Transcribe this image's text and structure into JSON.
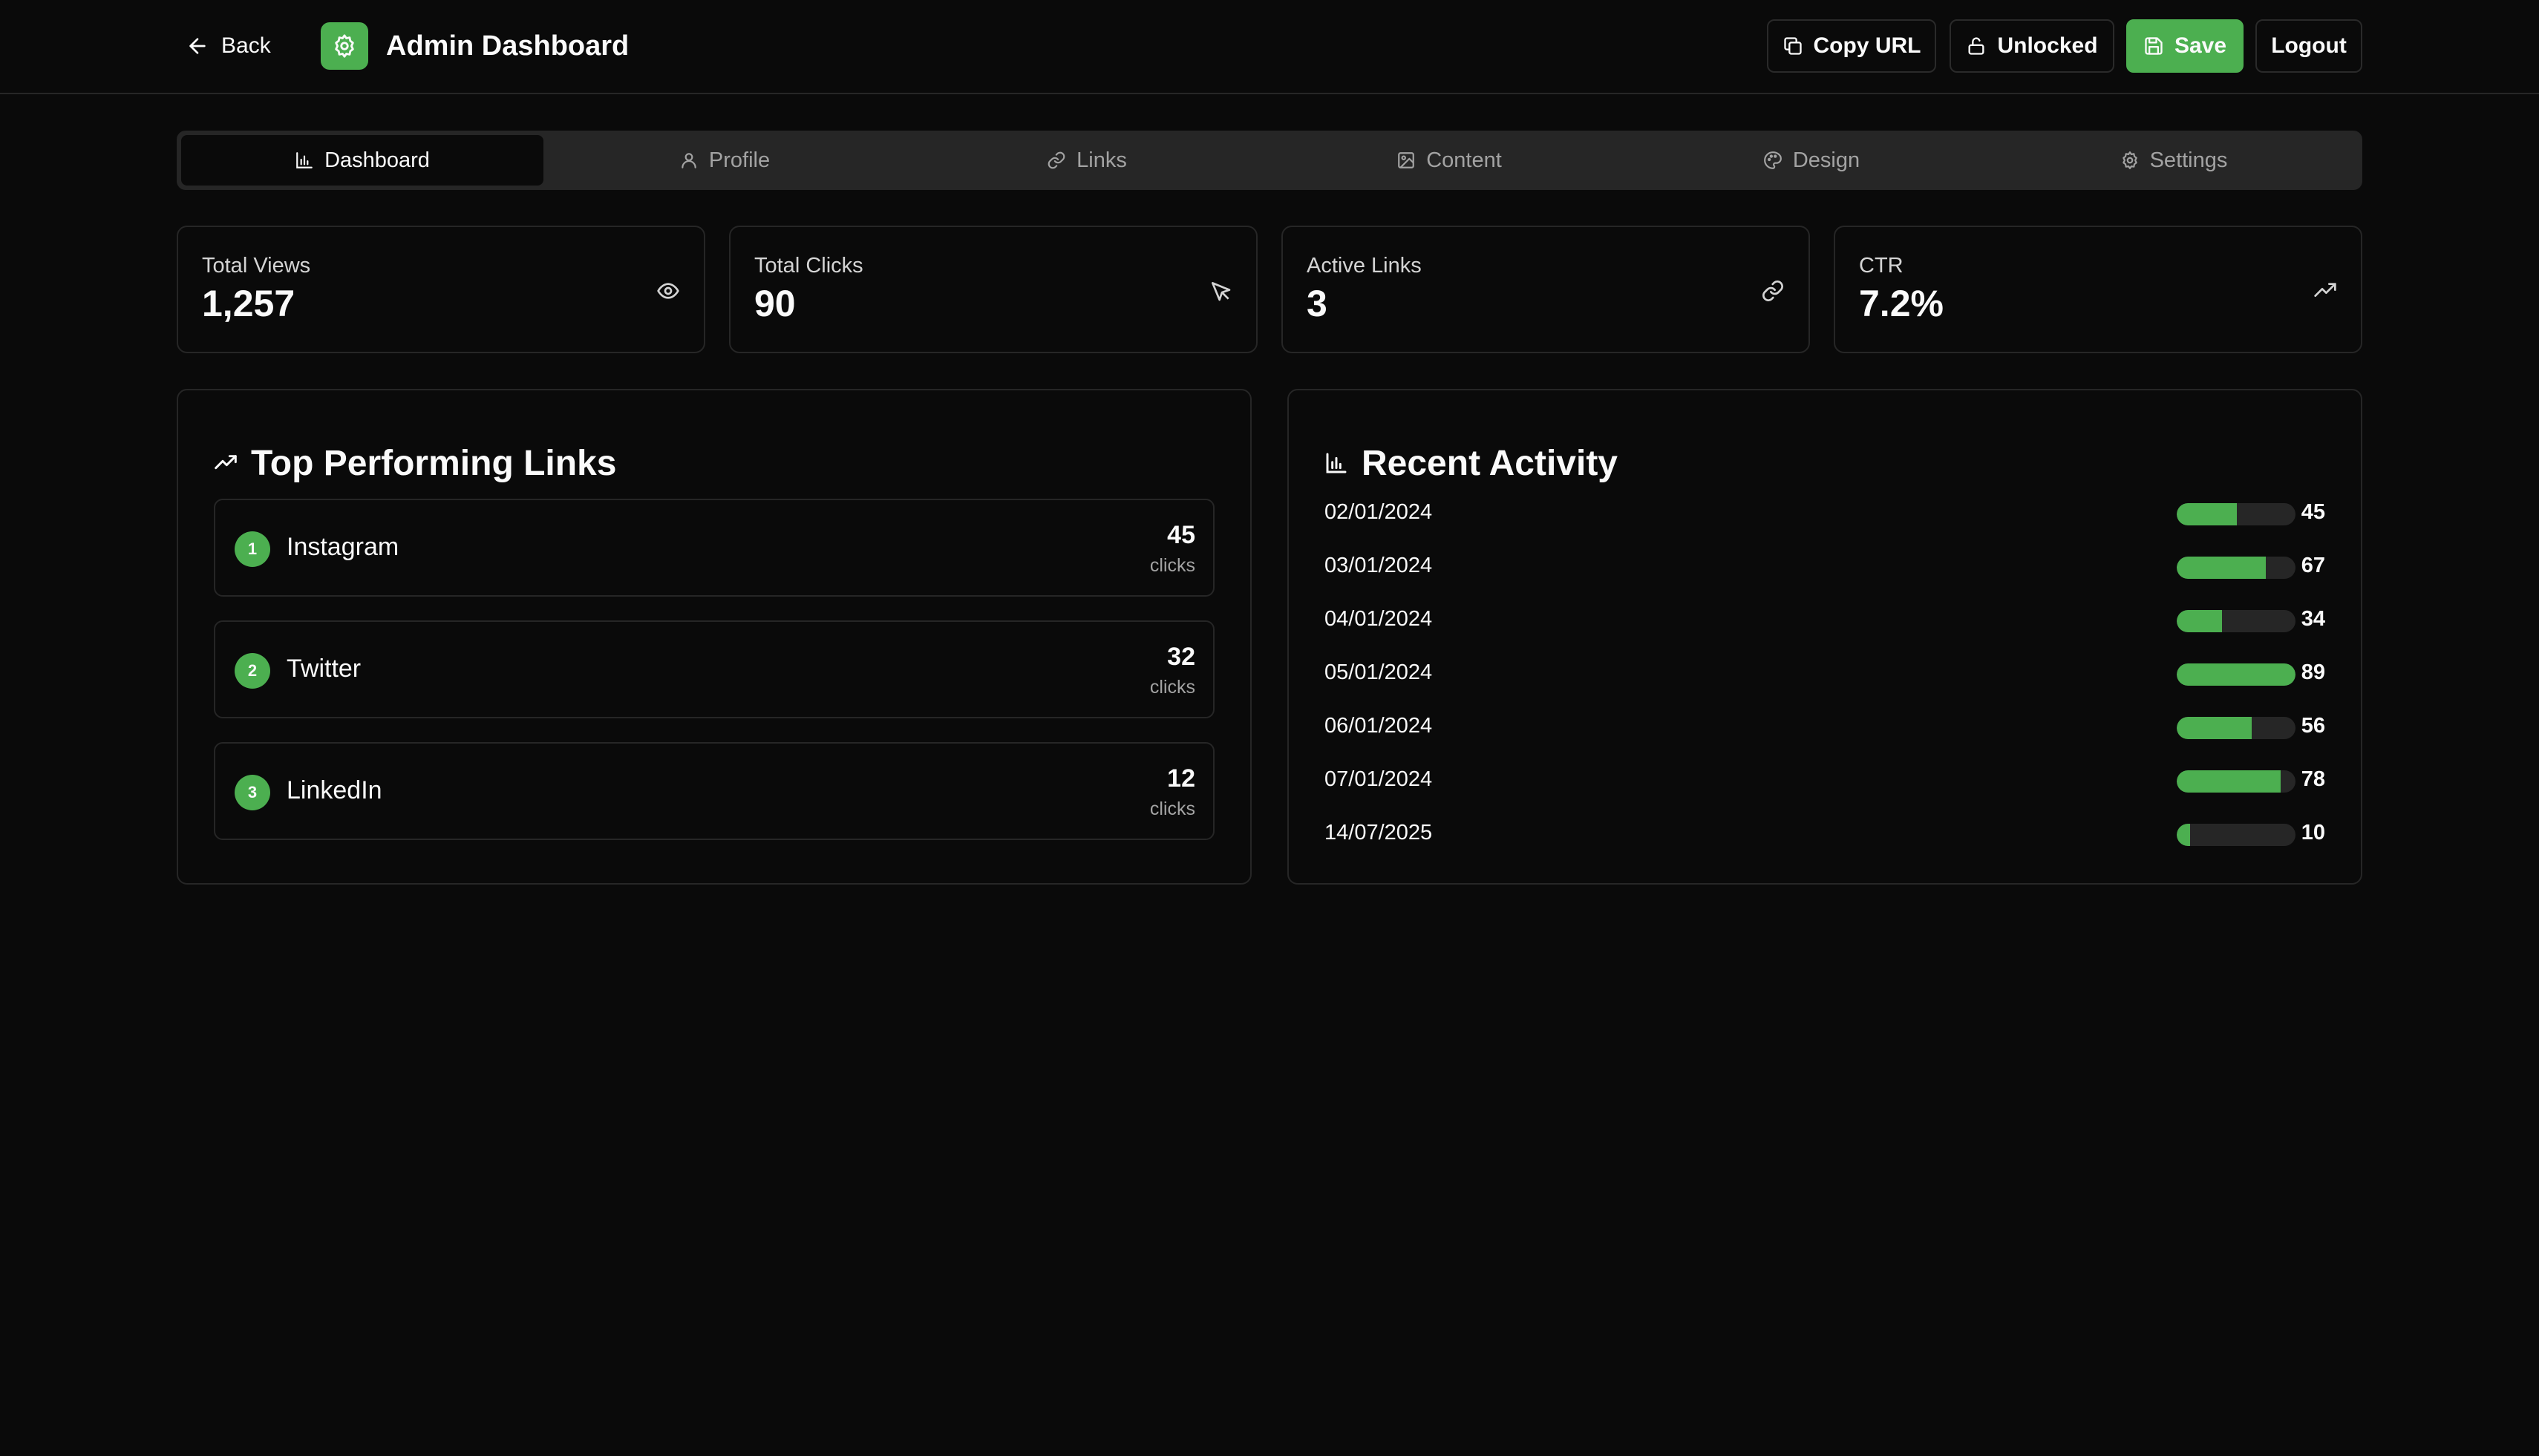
{
  "header": {
    "back_label": "Back",
    "title": "Admin Dashboard",
    "copy_url_label": "Copy URL",
    "lock_label": "Unlocked",
    "save_label": "Save",
    "logout_label": "Logout"
  },
  "tabs": [
    {
      "label": "Dashboard",
      "icon": "bar-chart-icon",
      "active": true
    },
    {
      "label": "Profile",
      "icon": "user-icon",
      "active": false
    },
    {
      "label": "Links",
      "icon": "link-icon",
      "active": false
    },
    {
      "label": "Content",
      "icon": "image-icon",
      "active": false
    },
    {
      "label": "Design",
      "icon": "palette-icon",
      "active": false
    },
    {
      "label": "Settings",
      "icon": "gear-icon",
      "active": false
    }
  ],
  "stats": [
    {
      "label": "Total Views",
      "value": "1,257",
      "icon": "eye-icon"
    },
    {
      "label": "Total Clicks",
      "value": "90",
      "icon": "pointer-icon"
    },
    {
      "label": "Active Links",
      "value": "3",
      "icon": "link-icon"
    },
    {
      "label": "CTR",
      "value": "7.2%",
      "icon": "trending-up-icon"
    }
  ],
  "top_links": {
    "title": "Top Performing Links",
    "items": [
      {
        "rank": "1",
        "name": "Instagram",
        "clicks": "45",
        "clicks_label": "clicks"
      },
      {
        "rank": "2",
        "name": "Twitter",
        "clicks": "32",
        "clicks_label": "clicks"
      },
      {
        "rank": "3",
        "name": "LinkedIn",
        "clicks": "12",
        "clicks_label": "clicks"
      }
    ]
  },
  "recent_activity": {
    "title": "Recent Activity",
    "max": 89,
    "items": [
      {
        "date": "02/01/2024",
        "value": "45"
      },
      {
        "date": "03/01/2024",
        "value": "67"
      },
      {
        "date": "04/01/2024",
        "value": "34"
      },
      {
        "date": "05/01/2024",
        "value": "89"
      },
      {
        "date": "06/01/2024",
        "value": "56"
      },
      {
        "date": "07/01/2024",
        "value": "78"
      },
      {
        "date": "14/07/2025",
        "value": "10"
      }
    ]
  },
  "colors": {
    "accent": "#4caf50",
    "background": "#0a0a0a",
    "border": "#262626"
  }
}
